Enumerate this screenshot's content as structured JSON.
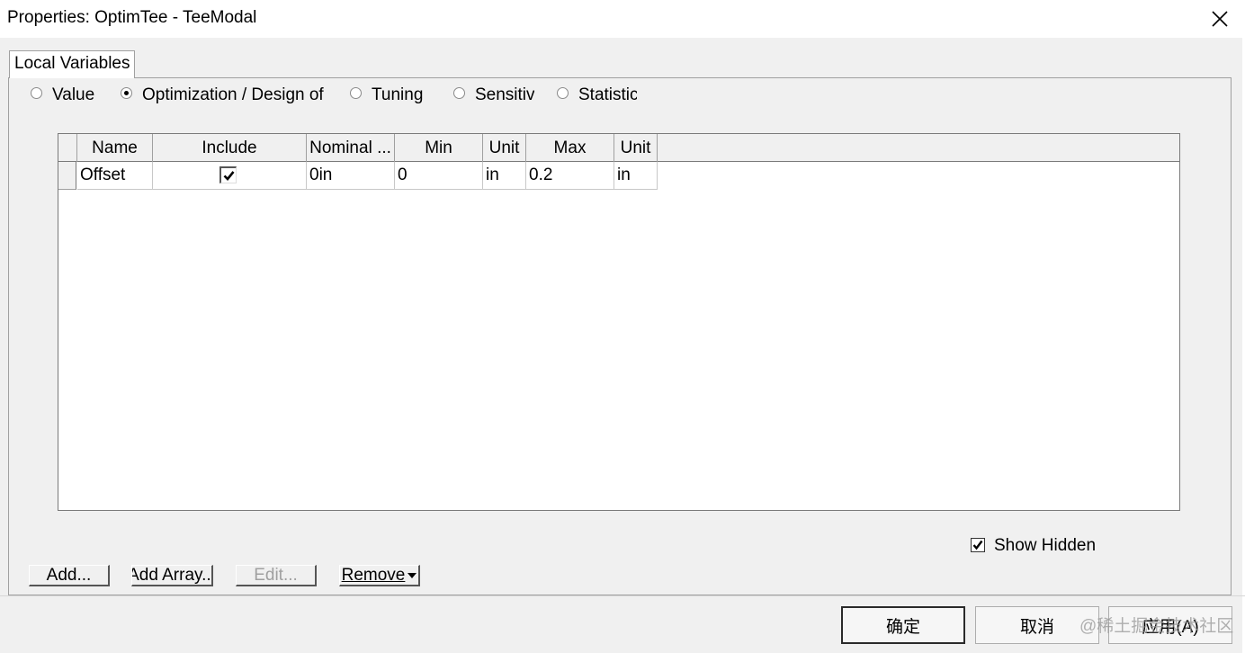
{
  "window": {
    "title": "Properties: OptimTee - TeeModal",
    "close_glyph": "✕"
  },
  "tab": {
    "label": "Local Variables"
  },
  "modes": [
    {
      "label": "Value",
      "selected": false
    },
    {
      "label": "Optimization / Design of",
      "selected": true
    },
    {
      "label": "Tuning",
      "selected": false
    },
    {
      "label": "Sensitiv",
      "selected": false
    },
    {
      "label": "Statistic",
      "selected": false
    }
  ],
  "table": {
    "columns": [
      "Name",
      "Include",
      "Nominal ...",
      "Min",
      "Unit",
      "Max",
      "Unit"
    ],
    "rows": [
      {
        "name": "Offset",
        "include": true,
        "nominal": "0in",
        "min": "0",
        "min_unit": "in",
        "max": "0.2",
        "max_unit": "in"
      }
    ]
  },
  "show_hidden": {
    "label": "Show Hidden",
    "checked": true
  },
  "buttons": {
    "add": "Add...",
    "add_array": "Add Array...",
    "edit": "Edit...",
    "remove": "Remove"
  },
  "dialog": {
    "ok": "确定",
    "cancel": "取消",
    "apply": "应用(A)"
  },
  "watermark": "@稀土掘金技术社区"
}
